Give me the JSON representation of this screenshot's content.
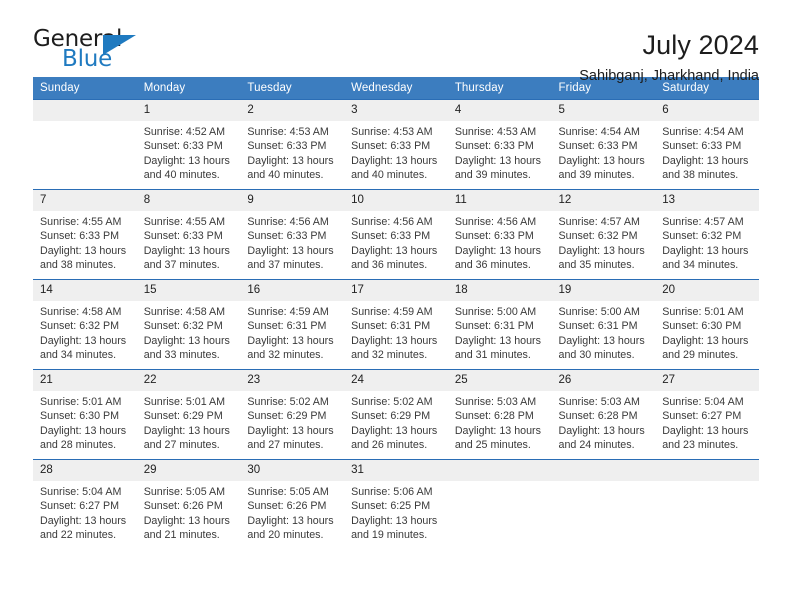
{
  "brand": {
    "name_part1": "General",
    "name_part2": "Blue",
    "accent_color": "#1f7ac0"
  },
  "header": {
    "title": "July 2024",
    "location": "Sahibganj, Jharkhand, India"
  },
  "weekday_headers": [
    "Sunday",
    "Monday",
    "Tuesday",
    "Wednesday",
    "Thursday",
    "Friday",
    "Saturday"
  ],
  "theme": {
    "header_bg": "#3c7dbf",
    "row_border": "#2a6db5",
    "daynum_bg": "#efefef"
  },
  "weeks": [
    [
      {
        "day": "",
        "lines": []
      },
      {
        "day": "1",
        "lines": [
          "Sunrise: 4:52 AM",
          "Sunset: 6:33 PM",
          "Daylight: 13 hours",
          "and 40 minutes."
        ]
      },
      {
        "day": "2",
        "lines": [
          "Sunrise: 4:53 AM",
          "Sunset: 6:33 PM",
          "Daylight: 13 hours",
          "and 40 minutes."
        ]
      },
      {
        "day": "3",
        "lines": [
          "Sunrise: 4:53 AM",
          "Sunset: 6:33 PM",
          "Daylight: 13 hours",
          "and 40 minutes."
        ]
      },
      {
        "day": "4",
        "lines": [
          "Sunrise: 4:53 AM",
          "Sunset: 6:33 PM",
          "Daylight: 13 hours",
          "and 39 minutes."
        ]
      },
      {
        "day": "5",
        "lines": [
          "Sunrise: 4:54 AM",
          "Sunset: 6:33 PM",
          "Daylight: 13 hours",
          "and 39 minutes."
        ]
      },
      {
        "day": "6",
        "lines": [
          "Sunrise: 4:54 AM",
          "Sunset: 6:33 PM",
          "Daylight: 13 hours",
          "and 38 minutes."
        ]
      }
    ],
    [
      {
        "day": "7",
        "lines": [
          "Sunrise: 4:55 AM",
          "Sunset: 6:33 PM",
          "Daylight: 13 hours",
          "and 38 minutes."
        ]
      },
      {
        "day": "8",
        "lines": [
          "Sunrise: 4:55 AM",
          "Sunset: 6:33 PM",
          "Daylight: 13 hours",
          "and 37 minutes."
        ]
      },
      {
        "day": "9",
        "lines": [
          "Sunrise: 4:56 AM",
          "Sunset: 6:33 PM",
          "Daylight: 13 hours",
          "and 37 minutes."
        ]
      },
      {
        "day": "10",
        "lines": [
          "Sunrise: 4:56 AM",
          "Sunset: 6:33 PM",
          "Daylight: 13 hours",
          "and 36 minutes."
        ]
      },
      {
        "day": "11",
        "lines": [
          "Sunrise: 4:56 AM",
          "Sunset: 6:33 PM",
          "Daylight: 13 hours",
          "and 36 minutes."
        ]
      },
      {
        "day": "12",
        "lines": [
          "Sunrise: 4:57 AM",
          "Sunset: 6:32 PM",
          "Daylight: 13 hours",
          "and 35 minutes."
        ]
      },
      {
        "day": "13",
        "lines": [
          "Sunrise: 4:57 AM",
          "Sunset: 6:32 PM",
          "Daylight: 13 hours",
          "and 34 minutes."
        ]
      }
    ],
    [
      {
        "day": "14",
        "lines": [
          "Sunrise: 4:58 AM",
          "Sunset: 6:32 PM",
          "Daylight: 13 hours",
          "and 34 minutes."
        ]
      },
      {
        "day": "15",
        "lines": [
          "Sunrise: 4:58 AM",
          "Sunset: 6:32 PM",
          "Daylight: 13 hours",
          "and 33 minutes."
        ]
      },
      {
        "day": "16",
        "lines": [
          "Sunrise: 4:59 AM",
          "Sunset: 6:31 PM",
          "Daylight: 13 hours",
          "and 32 minutes."
        ]
      },
      {
        "day": "17",
        "lines": [
          "Sunrise: 4:59 AM",
          "Sunset: 6:31 PM",
          "Daylight: 13 hours",
          "and 32 minutes."
        ]
      },
      {
        "day": "18",
        "lines": [
          "Sunrise: 5:00 AM",
          "Sunset: 6:31 PM",
          "Daylight: 13 hours",
          "and 31 minutes."
        ]
      },
      {
        "day": "19",
        "lines": [
          "Sunrise: 5:00 AM",
          "Sunset: 6:31 PM",
          "Daylight: 13 hours",
          "and 30 minutes."
        ]
      },
      {
        "day": "20",
        "lines": [
          "Sunrise: 5:01 AM",
          "Sunset: 6:30 PM",
          "Daylight: 13 hours",
          "and 29 minutes."
        ]
      }
    ],
    [
      {
        "day": "21",
        "lines": [
          "Sunrise: 5:01 AM",
          "Sunset: 6:30 PM",
          "Daylight: 13 hours",
          "and 28 minutes."
        ]
      },
      {
        "day": "22",
        "lines": [
          "Sunrise: 5:01 AM",
          "Sunset: 6:29 PM",
          "Daylight: 13 hours",
          "and 27 minutes."
        ]
      },
      {
        "day": "23",
        "lines": [
          "Sunrise: 5:02 AM",
          "Sunset: 6:29 PM",
          "Daylight: 13 hours",
          "and 27 minutes."
        ]
      },
      {
        "day": "24",
        "lines": [
          "Sunrise: 5:02 AM",
          "Sunset: 6:29 PM",
          "Daylight: 13 hours",
          "and 26 minutes."
        ]
      },
      {
        "day": "25",
        "lines": [
          "Sunrise: 5:03 AM",
          "Sunset: 6:28 PM",
          "Daylight: 13 hours",
          "and 25 minutes."
        ]
      },
      {
        "day": "26",
        "lines": [
          "Sunrise: 5:03 AM",
          "Sunset: 6:28 PM",
          "Daylight: 13 hours",
          "and 24 minutes."
        ]
      },
      {
        "day": "27",
        "lines": [
          "Sunrise: 5:04 AM",
          "Sunset: 6:27 PM",
          "Daylight: 13 hours",
          "and 23 minutes."
        ]
      }
    ],
    [
      {
        "day": "28",
        "lines": [
          "Sunrise: 5:04 AM",
          "Sunset: 6:27 PM",
          "Daylight: 13 hours",
          "and 22 minutes."
        ]
      },
      {
        "day": "29",
        "lines": [
          "Sunrise: 5:05 AM",
          "Sunset: 6:26 PM",
          "Daylight: 13 hours",
          "and 21 minutes."
        ]
      },
      {
        "day": "30",
        "lines": [
          "Sunrise: 5:05 AM",
          "Sunset: 6:26 PM",
          "Daylight: 13 hours",
          "and 20 minutes."
        ]
      },
      {
        "day": "31",
        "lines": [
          "Sunrise: 5:06 AM",
          "Sunset: 6:25 PM",
          "Daylight: 13 hours",
          "and 19 minutes."
        ]
      },
      {
        "day": "",
        "lines": []
      },
      {
        "day": "",
        "lines": []
      },
      {
        "day": "",
        "lines": []
      }
    ]
  ]
}
